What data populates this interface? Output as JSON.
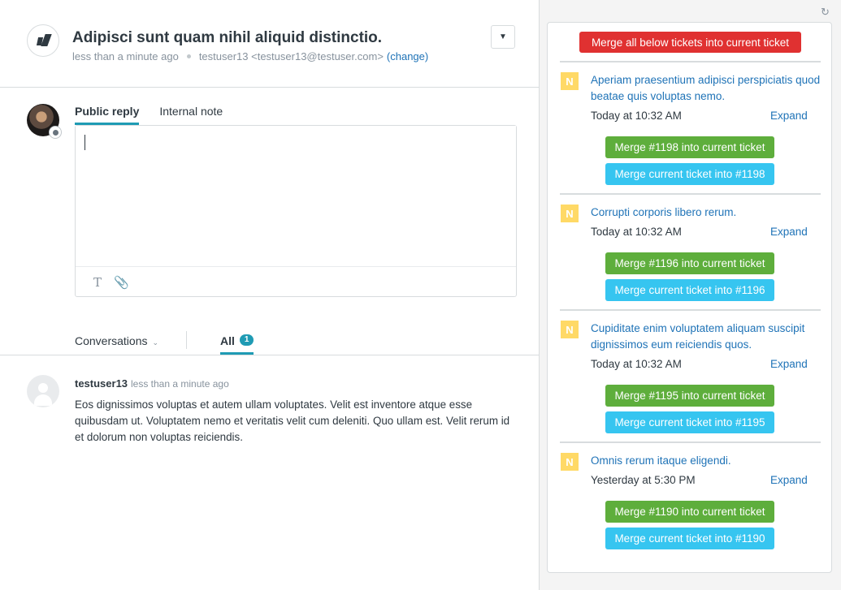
{
  "header": {
    "title": "Adipisci sunt quam nihil aliquid distinctio.",
    "created": "less than a minute ago",
    "requester": "testuser13 <testuser13@testuser.com>",
    "change_label": "(change)",
    "dropdown_icon": "chevron-down-icon"
  },
  "composer": {
    "tabs": [
      {
        "label": "Public reply",
        "active": true
      },
      {
        "label": "Internal note",
        "active": false
      }
    ],
    "placeholder": "",
    "toolbar": {
      "format_icon": "T",
      "attach_icon": "paperclip-icon"
    }
  },
  "feed": {
    "filter_label": "Conversations",
    "all_label": "All",
    "all_count": "1",
    "comments": [
      {
        "author": "testuser13",
        "time": "less than a minute ago",
        "body": "Eos dignissimos voluptas et autem ullam voluptates. Velit est inventore atque esse quibusdam ut. Voluptatem nemo et veritatis velit cum deleniti. Quo ullam est. Velit rerum id et dolorum non voluptas reiciendis."
      }
    ]
  },
  "merge_panel": {
    "refresh_icon": "refresh-icon",
    "merge_all_label": "Merge all below tickets into current ticket",
    "tickets": [
      {
        "status": "N",
        "subject": "Aperiam praesentium adipisci perspiciatis quod beatae quis voluptas nemo.",
        "date": "Today at 10:32 AM",
        "expand": "Expand",
        "merge_into_current": "Merge #1198 into current ticket",
        "merge_current_into": "Merge current ticket into #1198"
      },
      {
        "status": "N",
        "subject": "Corrupti corporis libero rerum.",
        "date": "Today at 10:32 AM",
        "expand": "Expand",
        "merge_into_current": "Merge #1196 into current ticket",
        "merge_current_into": "Merge current ticket into #1196"
      },
      {
        "status": "N",
        "subject": "Cupiditate enim voluptatem aliquam suscipit dignissimos eum reiciendis quos.",
        "date": "Today at 10:32 AM",
        "expand": "Expand",
        "merge_into_current": "Merge #1195 into current ticket",
        "merge_current_into": "Merge current ticket into #1195"
      },
      {
        "status": "N",
        "subject": "Omnis rerum itaque eligendi.",
        "date": "Yesterday at 5:30 PM",
        "expand": "Expand",
        "merge_into_current": "Merge #1190 into current ticket",
        "merge_current_into": "Merge current ticket into #1190"
      }
    ]
  },
  "colors": {
    "accent_teal": "#1f9bb4",
    "link_blue": "#1f73b7",
    "danger_red": "#e03131",
    "merge_green": "#5eae3c",
    "merge_blue": "#36c5f0",
    "status_new_yellow": "#ffd966"
  }
}
